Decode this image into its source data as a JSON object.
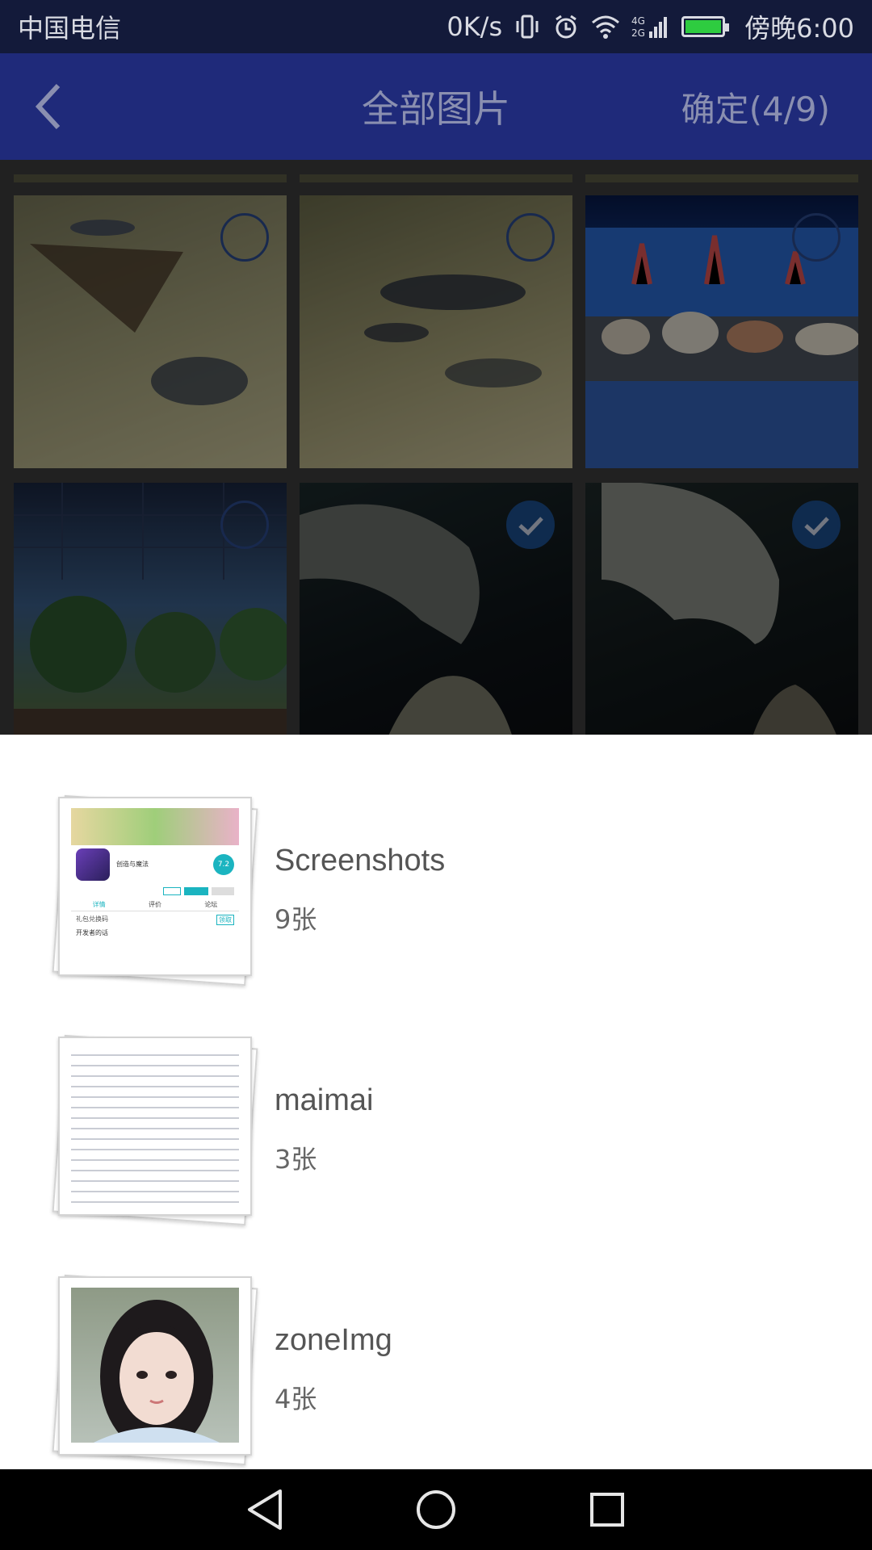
{
  "status_bar": {
    "carrier": "中国电信",
    "net_speed": "0K/s",
    "network_type": "4G 2G",
    "time": "傍晚6:00",
    "icons": [
      "vibrate-icon",
      "alarm-icon",
      "wifi-icon",
      "signal-icon",
      "battery-icon"
    ]
  },
  "header": {
    "back_icon": "chevron-left-icon",
    "title": "全部图片",
    "confirm_label": "确定(4/9)"
  },
  "photos": [
    {
      "subject": "aquarium-fish",
      "selected": false
    },
    {
      "subject": "aquarium-fish",
      "selected": false
    },
    {
      "subject": "seashell-display",
      "selected": false
    },
    {
      "subject": "greenhouse",
      "selected": false
    },
    {
      "subject": "dinosaur-model",
      "selected": true
    },
    {
      "subject": "dinosaur-model",
      "selected": true
    }
  ],
  "albums": [
    {
      "name": "Screenshots",
      "count": "9张",
      "thumb": "app-screenshot",
      "thumb_text": {
        "app_name": "创造与魔法",
        "rating": "7.2",
        "tabs": [
          "详情",
          "评价",
          "论坛"
        ],
        "line1": "礼包兑换码",
        "line2": "开发者的话",
        "tag": "领取"
      }
    },
    {
      "name": "maimai",
      "count": "3张",
      "thumb": "text-document"
    },
    {
      "name": "zoneImg",
      "count": "4张",
      "thumb": "portrait-photo"
    }
  ],
  "nav_bar": {
    "icons": [
      "back-triangle-icon",
      "home-circle-icon",
      "recents-square-icon"
    ]
  },
  "colors": {
    "header_bg": "#1f2a7a",
    "status_bg": "#131a3a",
    "check_selected": "#1d4f8e",
    "sheet_bg": "#ffffff"
  }
}
